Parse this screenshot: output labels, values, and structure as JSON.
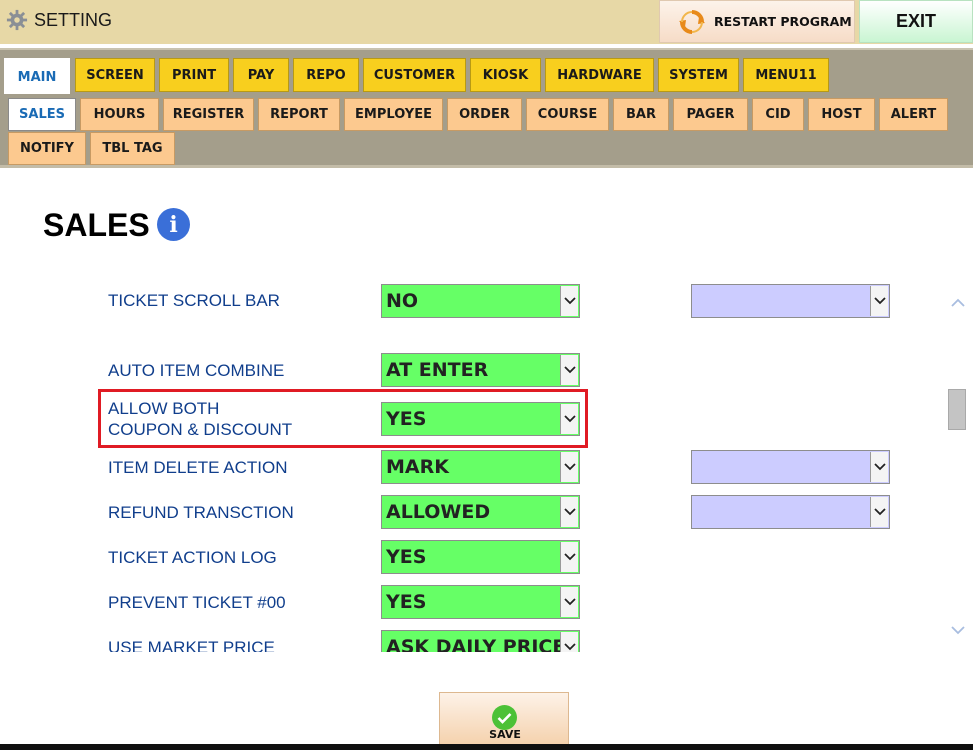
{
  "window": {
    "title": "SETTING"
  },
  "header": {
    "restart_label": "RESTART PROGRAM",
    "exit_label": "EXIT"
  },
  "main_tabs": [
    {
      "label": "MAIN",
      "active": true
    },
    {
      "label": "SCREEN"
    },
    {
      "label": "PRINT"
    },
    {
      "label": "PAY"
    },
    {
      "label": "REPO"
    },
    {
      "label": "CUSTOMER"
    },
    {
      "label": "KIOSK"
    },
    {
      "label": "HARDWARE"
    },
    {
      "label": "SYSTEM"
    },
    {
      "label": "MENU11"
    }
  ],
  "sub_tabs": [
    {
      "label": "SALES",
      "active": true
    },
    {
      "label": "HOURS"
    },
    {
      "label": "REGISTER"
    },
    {
      "label": "REPORT"
    },
    {
      "label": "EMPLOYEE"
    },
    {
      "label": "ORDER"
    },
    {
      "label": "COURSE"
    },
    {
      "label": "BAR"
    },
    {
      "label": "PAGER"
    },
    {
      "label": "CID"
    },
    {
      "label": "HOST"
    },
    {
      "label": "ALERT"
    },
    {
      "label": "NOTIFY"
    },
    {
      "label": "TBL TAG"
    }
  ],
  "page": {
    "title": "SALES"
  },
  "settings": [
    {
      "label": "TICKET SCROLL BAR",
      "value": "NO",
      "secondary": ""
    },
    {
      "label": "AUTO ITEM COMBINE",
      "value": "AT ENTER"
    },
    {
      "label": "ALLOW BOTH\nCOUPON & DISCOUNT",
      "value": "YES",
      "highlighted": true
    },
    {
      "label": "ITEM DELETE ACTION",
      "value": "MARK",
      "secondary": ""
    },
    {
      "label": "REFUND TRANSCTION",
      "value": "ALLOWED",
      "secondary": ""
    },
    {
      "label": "TICKET ACTION LOG",
      "value": "YES"
    },
    {
      "label": "PREVENT TICKET #00",
      "value": "YES"
    },
    {
      "label": "USE MARKET PRICE",
      "value": "ASK DAILY PRICE"
    }
  ],
  "footer": {
    "save_label": "SAVE"
  },
  "colors": {
    "value_green": "#66ff66",
    "secondary_lavender": "#ccccff",
    "highlight_red": "#e01b24",
    "main_tab_yellow": "#f8cf1e",
    "sub_tab_peach": "#fcc98f"
  }
}
